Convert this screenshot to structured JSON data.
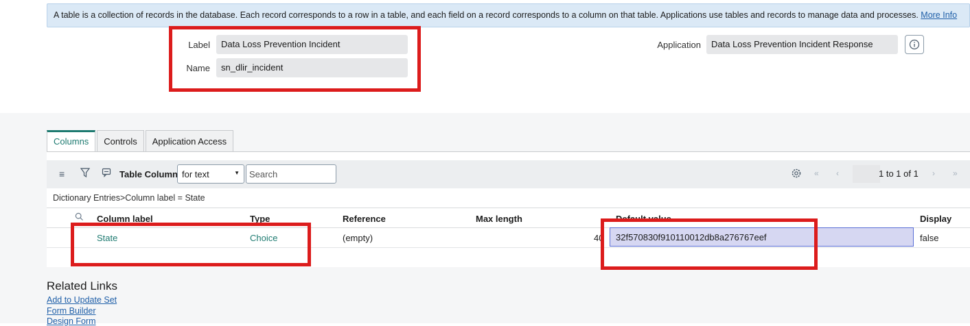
{
  "info_banner": {
    "text": "A table is a collection of records in the database. Each record corresponds to a row in a table, and each field on a record corresponds to a column on that table. Applications use tables and records to manage data and processes.",
    "link": "More Info"
  },
  "form": {
    "label_caption": "Label",
    "label_value": "Data Loss Prevention Incident",
    "name_caption": "Name",
    "name_value": "sn_dlir_incident",
    "application_caption": "Application",
    "application_value": "Data Loss Prevention Incident Response"
  },
  "tabs": [
    {
      "label": "Columns",
      "active": true
    },
    {
      "label": "Controls",
      "active": false
    },
    {
      "label": "Application Access",
      "active": false
    }
  ],
  "list_toolbar": {
    "title": "Table Columns",
    "filter_select": "for text",
    "search_placeholder": "Search",
    "pager_text": "1  to 1 of 1"
  },
  "breadcrumb": "Dictionary Entries>Column label = State",
  "table": {
    "headers": {
      "column_label": "Column label",
      "type": "Type",
      "reference": "Reference",
      "max_length": "Max length",
      "default_value": "Default value",
      "display": "Display"
    },
    "rows": [
      {
        "column_label": "State",
        "type": "Choice",
        "reference": "(empty)",
        "max_length": "40",
        "default_value": "32f570830f910110012db8a276767eef",
        "display": "false"
      }
    ]
  },
  "related_links": {
    "title": "Related Links",
    "links": [
      "Add to Update Set",
      "Form Builder",
      "Design Form"
    ]
  },
  "colors": {
    "accent": "#1d7a70",
    "annotation": "#dc1c1c",
    "link": "#1f5fa8"
  }
}
